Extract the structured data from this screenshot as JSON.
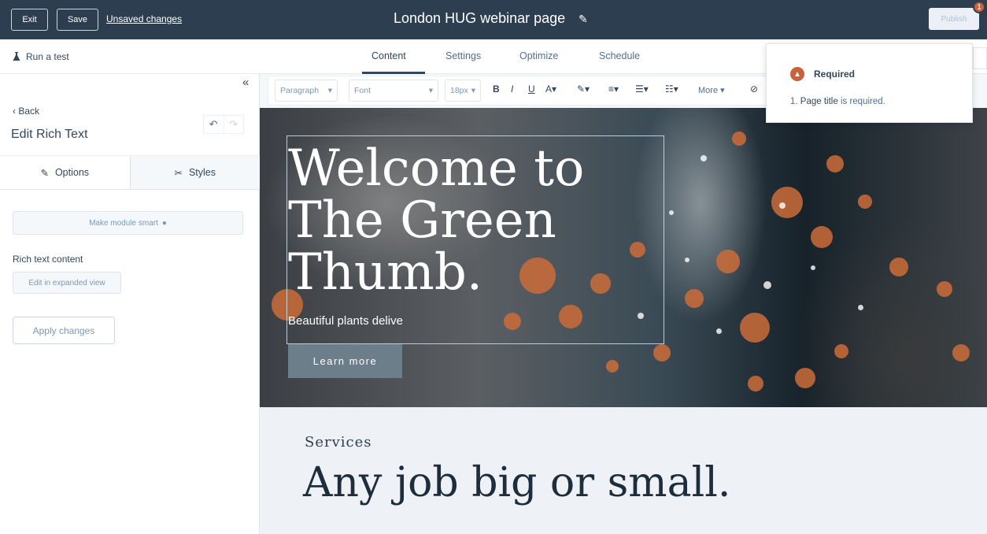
{
  "topbar": {
    "exit_label": "Exit",
    "save_label": "Save",
    "unsaved_label": "Unsaved changes",
    "page_title": "London HUG webinar page",
    "publish_label": "Publish",
    "publish_badge": "1"
  },
  "subnav": {
    "run_test_label": "Run a test",
    "tabs": [
      {
        "label": "Content"
      },
      {
        "label": "Settings"
      },
      {
        "label": "Optimize"
      },
      {
        "label": "Schedule"
      }
    ]
  },
  "sidebar": {
    "back_label": "Back",
    "title": "Edit Rich Text",
    "tabs": [
      {
        "label": "Options"
      },
      {
        "label": "Styles"
      }
    ],
    "make_smart_label": "Make module smart",
    "rich_text_label": "Rich text content",
    "expanded_view_label": "Edit in expanded view",
    "apply_label": "Apply changes"
  },
  "toolbar": {
    "paragraph": "Paragraph",
    "font": "Font",
    "size": "18px",
    "more_label": "More"
  },
  "hero": {
    "title_lines": [
      "Welcome to",
      "The Green",
      "Thumb."
    ],
    "subtitle": "Beautiful plants delive",
    "button_label": "Learn more"
  },
  "services": {
    "label": "Services",
    "heading": "Any job big or small."
  },
  "popover": {
    "title": "Required",
    "message_prefix": "1. ",
    "message_bold": "Page title",
    "message_suffix": " is required."
  },
  "colors": {
    "topbar": "#2d3e50",
    "accent_orange": "#c9623a",
    "button_grey": "#6c7e8a"
  }
}
